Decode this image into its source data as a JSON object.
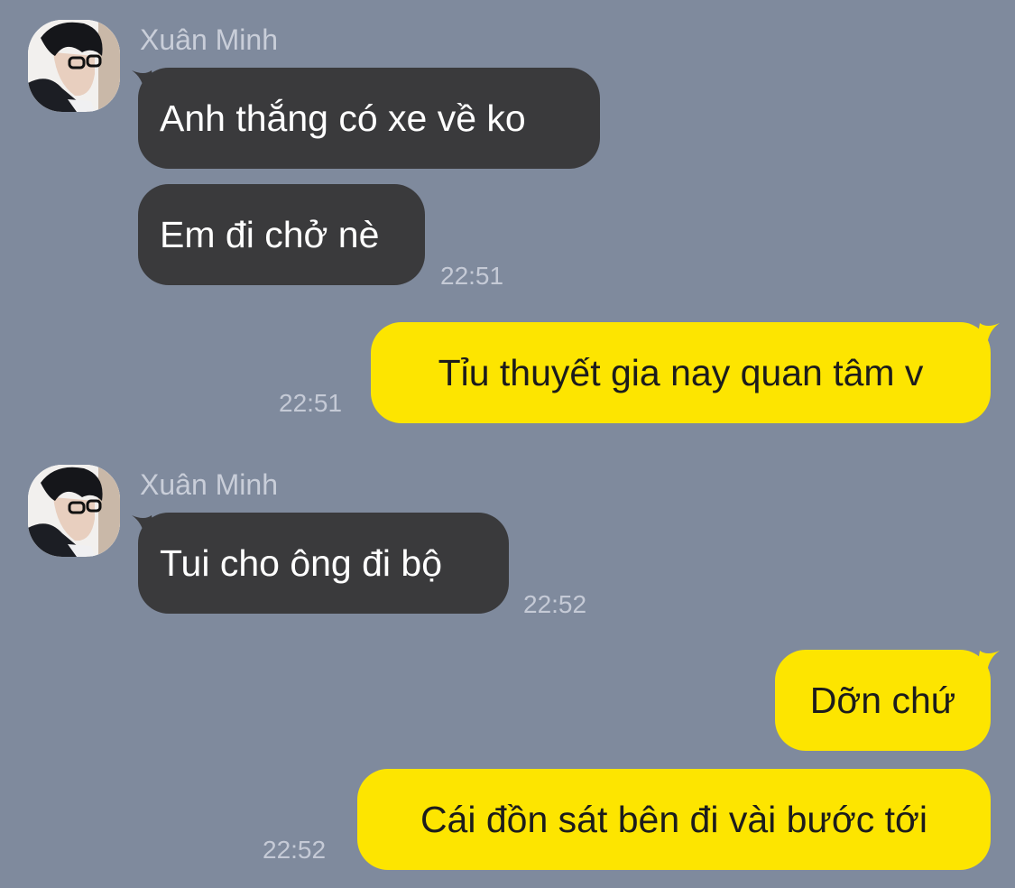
{
  "chat": {
    "groups": [
      {
        "sender": "Xuân Minh",
        "messages": [
          "Anh thắng có xe về ko",
          "Em đi chở nè"
        ],
        "time": "22:51"
      },
      {
        "messages": [
          "Tỉu thuyết gia nay quan tâm v"
        ],
        "time": "22:51"
      },
      {
        "sender": "Xuân Minh",
        "messages": [
          "Tui cho ông đi bộ"
        ],
        "time": "22:52"
      },
      {
        "messages": [
          "Dỡn chứ",
          "Cái đồn sát bên đi vài bước tới"
        ],
        "time": "22:52"
      }
    ]
  },
  "colors": {
    "background": "#7f8a9d",
    "incoming_bubble": "#3a3a3c",
    "outgoing_bubble": "#fde500",
    "incoming_text": "#ffffff",
    "outgoing_text": "#1c1c1c",
    "meta_text": "#c5cad6"
  },
  "icons": {
    "contact_avatar": "avatar-photo"
  }
}
